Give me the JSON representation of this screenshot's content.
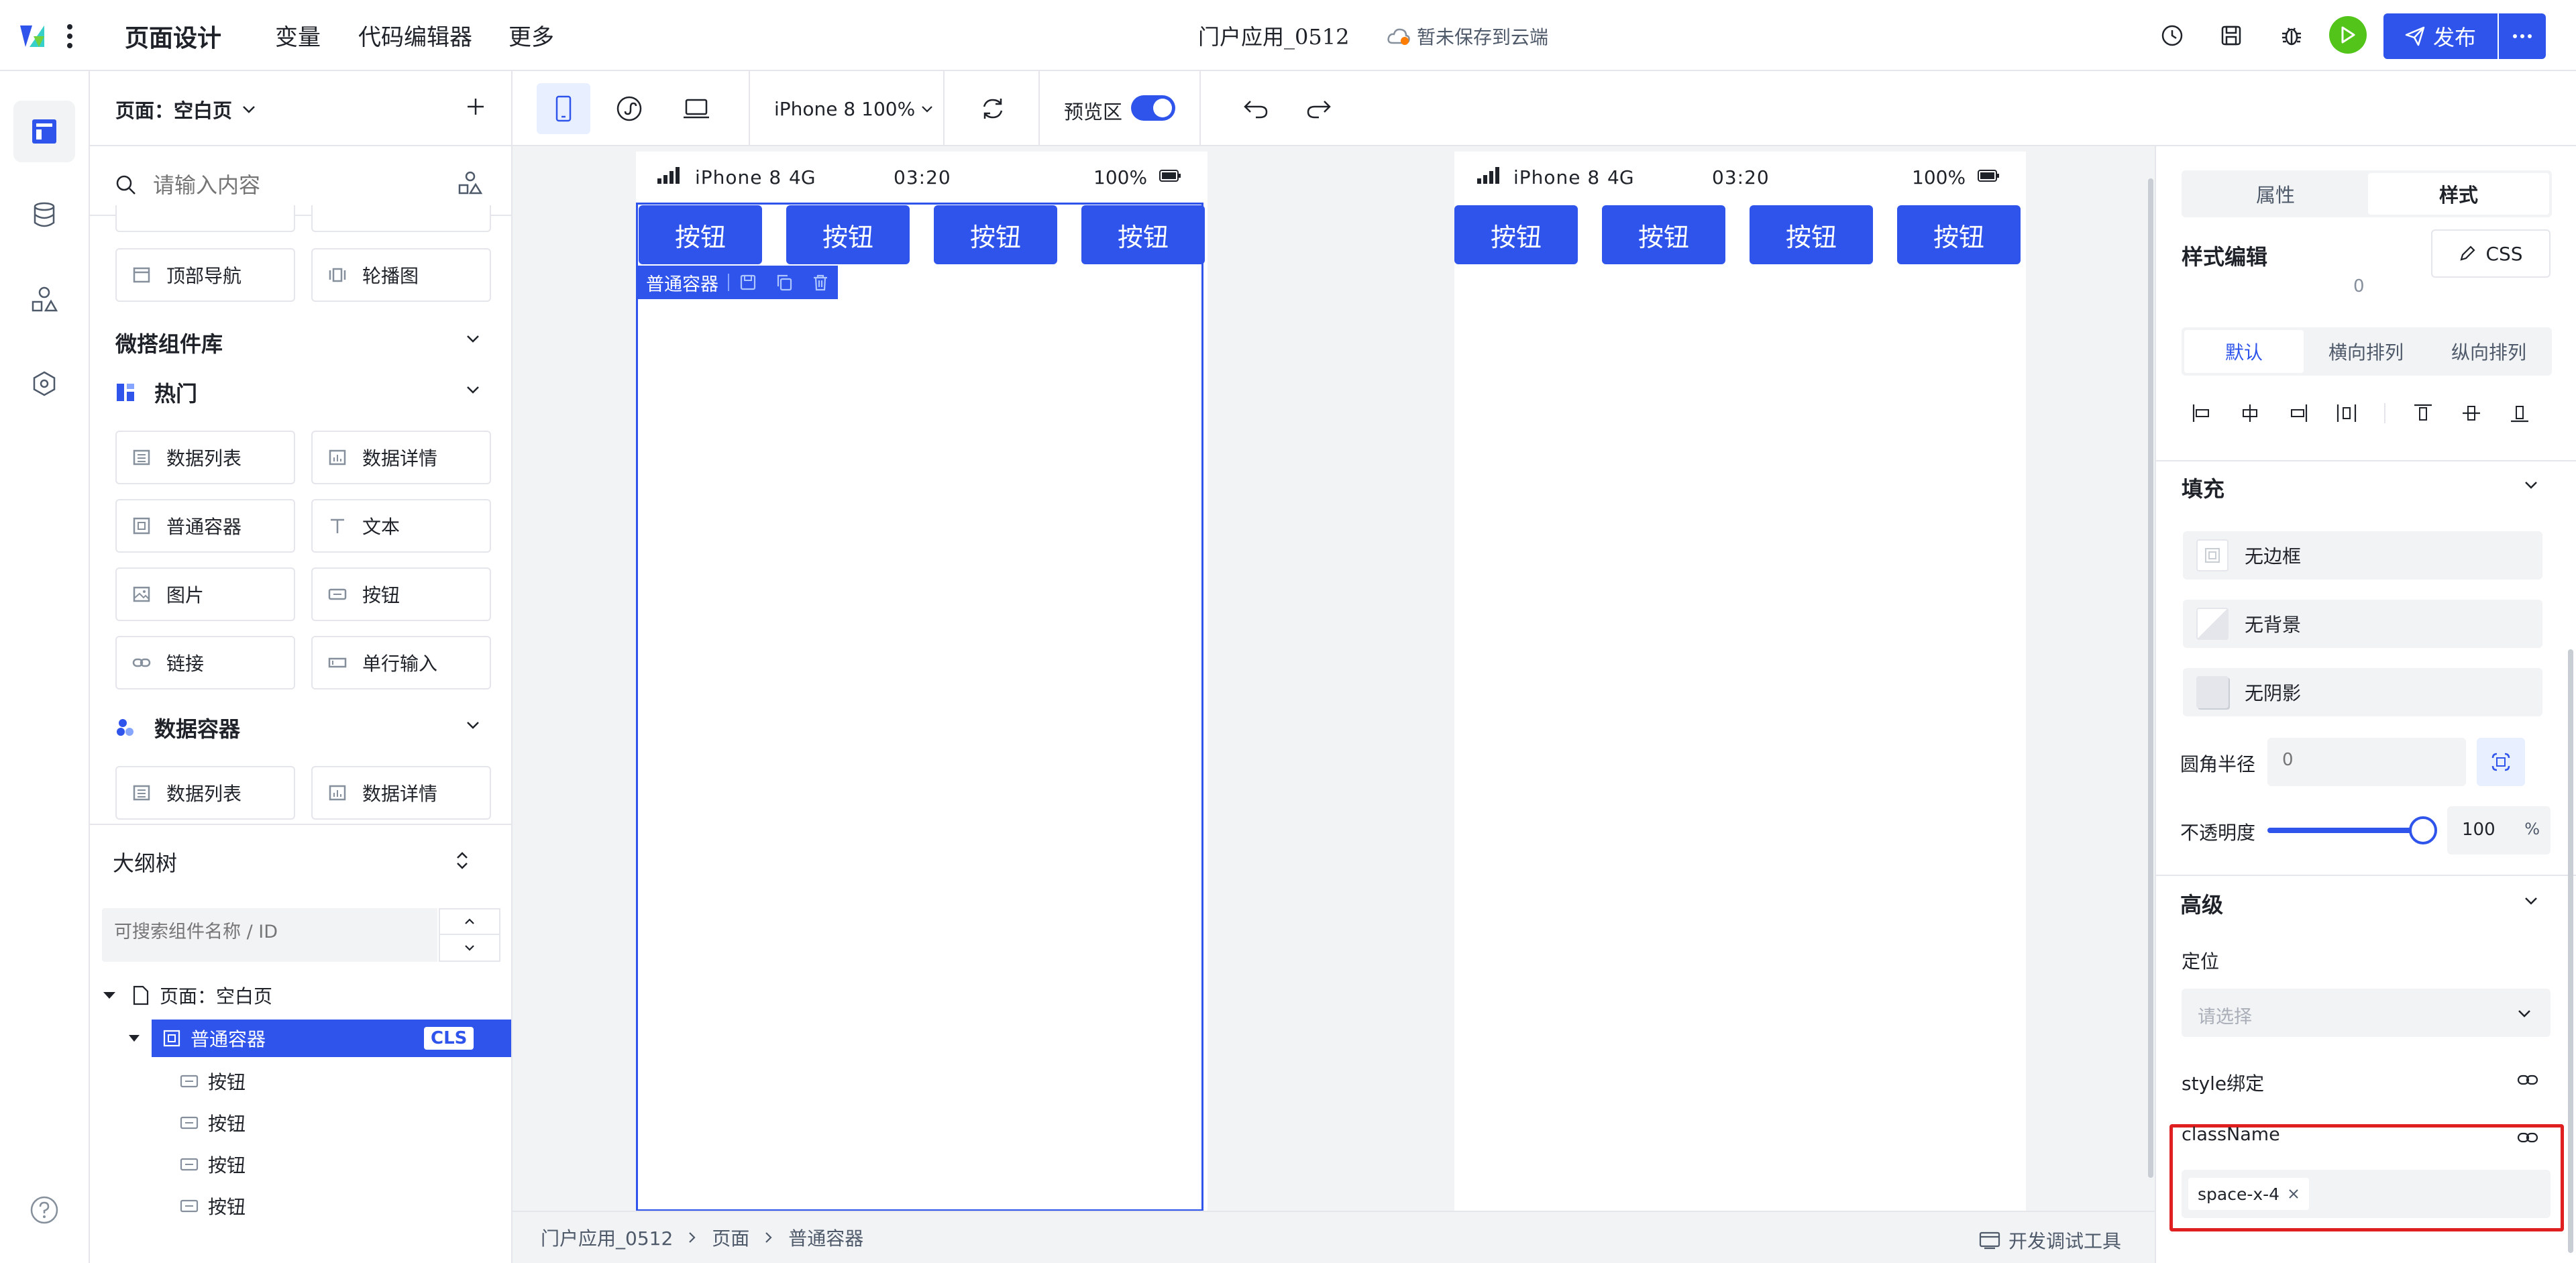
{
  "topbar": {
    "tabs": [
      "页面设计",
      "变量",
      "代码编辑器",
      "更多"
    ],
    "app_title": "门户应用_0512",
    "save_status": "暂未保存到云端",
    "publish_label": "发布"
  },
  "left_panel": {
    "page_selector": "页面：空白页",
    "search_placeholder": "请输入内容",
    "top_components": [
      {
        "label": "顶部导航",
        "icon": "top-nav-icon"
      },
      {
        "label": "轮播图",
        "icon": "carousel-icon"
      }
    ],
    "library_title": "微搭组件库",
    "hot_title": "热门",
    "hot_components": [
      {
        "label": "数据列表",
        "icon": "data-list-icon"
      },
      {
        "label": "数据详情",
        "icon": "data-detail-icon"
      },
      {
        "label": "普通容器",
        "icon": "container-icon"
      },
      {
        "label": "文本",
        "icon": "text-icon"
      },
      {
        "label": "图片",
        "icon": "image-icon"
      },
      {
        "label": "按钮",
        "icon": "button-icon"
      },
      {
        "label": "链接",
        "icon": "link-icon"
      },
      {
        "label": "单行输入",
        "icon": "input-icon"
      }
    ],
    "data_container_title": "数据容器",
    "data_components": [
      {
        "label": "数据列表",
        "icon": "data-list-icon"
      },
      {
        "label": "数据详情",
        "icon": "data-detail-icon"
      }
    ],
    "outline": {
      "title": "大纲树",
      "search_placeholder": "可搜索组件名称 / ID",
      "nodes": [
        {
          "label": "页面：空白页",
          "level": 0
        },
        {
          "label": "普通容器",
          "level": 1,
          "badge": "CLS",
          "selected": true
        },
        {
          "label": "按钮",
          "level": 2
        },
        {
          "label": "按钮",
          "level": 2
        },
        {
          "label": "按钮",
          "level": 2
        },
        {
          "label": "按钮",
          "level": 2
        }
      ]
    }
  },
  "toolbar": {
    "device": "iPhone 8 100%",
    "preview_label": "预览区",
    "preview_on": true
  },
  "canvas": {
    "status_bar": {
      "carrier": "iPhone 8",
      "network": "4G",
      "time": "03:20",
      "battery": "100%"
    },
    "buttons": [
      "按钮",
      "按钮",
      "按钮",
      "按钮"
    ],
    "selection_label": "普通容器",
    "preview_buttons": [
      "按钮",
      "按钮",
      "按钮",
      "按钮"
    ]
  },
  "breadcrumb": {
    "items": [
      "门户应用_0512",
      "页面",
      "普通容器"
    ],
    "devtools_label": "开发调试工具"
  },
  "right_panel": {
    "tabs": [
      "属性",
      "样式"
    ],
    "active_tab": "样式",
    "style_title": "样式编辑",
    "css_label": "CSS",
    "spacing_value": "0",
    "layout_tabs": [
      "默认",
      "横向排列",
      "纵向排列"
    ],
    "fill_title": "填充",
    "fill_items": [
      "无边框",
      "无背景",
      "无阴影"
    ],
    "radius_label": "圆角半径",
    "radius_placeholder": "0",
    "opacity_label": "不透明度",
    "opacity_value": "100",
    "opacity_unit": "%",
    "opacity_fraction": 1.0,
    "advanced_title": "高级",
    "position_label": "定位",
    "position_placeholder": "请选择",
    "style_bind_label": "style绑定",
    "classname_label": "className",
    "classname_tag": "space-x-4"
  },
  "colors": {
    "primary": "#2f54eb",
    "highlight": "#e02020",
    "canvas_bg": "#f2f3f5",
    "run_green": "#52c41a"
  }
}
